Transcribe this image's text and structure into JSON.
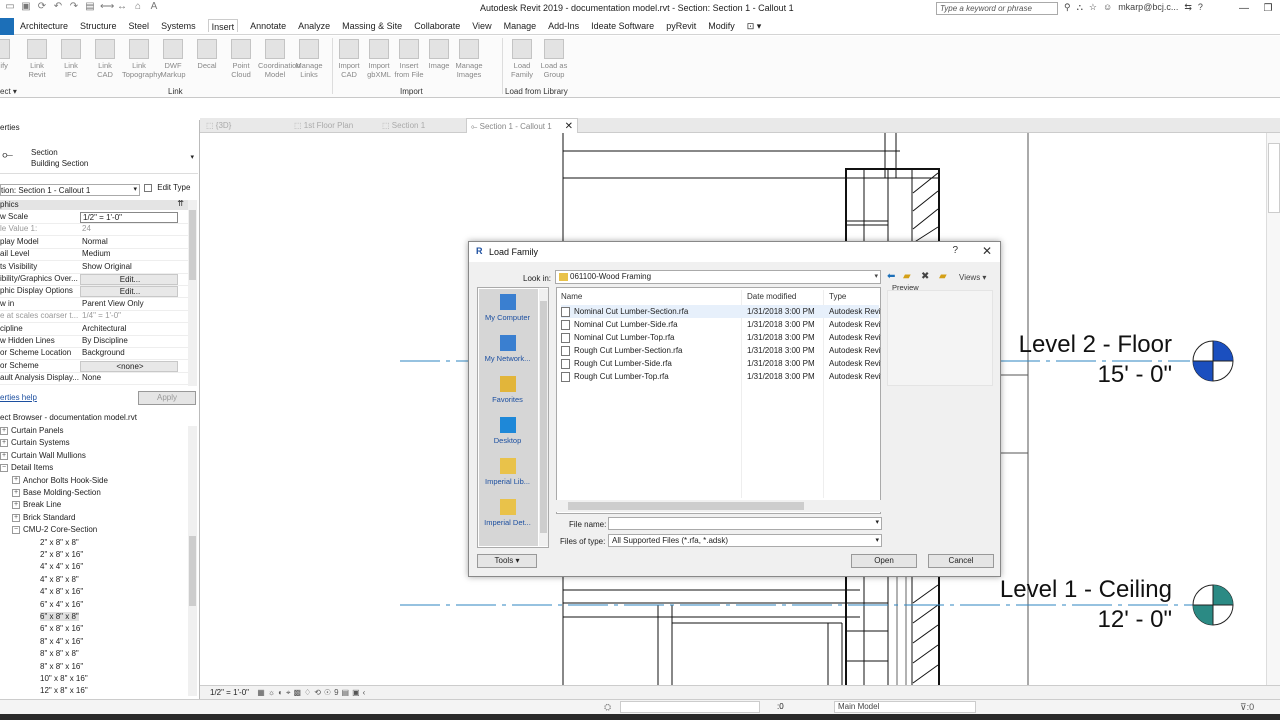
{
  "titlebar": {
    "title": "Autodesk Revit 2019 - documentation model.rvt - Section: Section 1 - Callout 1",
    "search_placeholder": "Type a keyword or phrase",
    "user": "mkarp@bcj.c..."
  },
  "menu": {
    "tabs": [
      "Architecture",
      "Structure",
      "Steel",
      "Systems",
      "Insert",
      "Annotate",
      "Analyze",
      "Massing & Site",
      "Collaborate",
      "View",
      "Manage",
      "Add-Ins",
      "Ideate Software",
      "pyRevit",
      "Modify"
    ],
    "active": "Insert"
  },
  "ribbon": {
    "link_buttons": [
      "Link\nRevit",
      "Link\nIFC",
      "Link\nCAD",
      "Link\nTopography",
      "DWF\nMarkup",
      "Decal",
      "Point\nCloud",
      "Coordination\nModel",
      "Manage\nLinks"
    ],
    "import_buttons": [
      "Import\nCAD",
      "Import\ngbXML",
      "Insert\nfrom File",
      "Image",
      "Manage\nImages"
    ],
    "library_buttons": [
      "Load\nFamily",
      "Load as\nGroup"
    ],
    "panels": {
      "link": "Link",
      "import": "Import",
      "library": "Load from Library"
    },
    "left_clipped": [
      "odify",
      "ect"
    ]
  },
  "properties": {
    "header": "erties",
    "type_name": "Section",
    "type_sub": "Building Section",
    "instance": "tion: Section 1 - Callout 1",
    "edit_type": "Edit Type",
    "section": "phics",
    "rows": [
      {
        "k": "w Scale",
        "v": "1/2\" = 1'-0\"",
        "style": "box"
      },
      {
        "k": "le Value    1:",
        "v": "24",
        "style": "grey"
      },
      {
        "k": "play Model",
        "v": "Normal",
        "style": ""
      },
      {
        "k": "ail Level",
        "v": "Medium",
        "style": ""
      },
      {
        "k": "ts Visibility",
        "v": "Show Original",
        "style": ""
      },
      {
        "k": "ibility/Graphics Over...",
        "v": "Edit...",
        "style": "btn"
      },
      {
        "k": "phic Display Options",
        "v": "Edit...",
        "style": "btn"
      },
      {
        "k": "w in",
        "v": "Parent View Only",
        "style": ""
      },
      {
        "k": "e at scales coarser t...",
        "v": "1/4\" = 1'-0\"",
        "style": "grey"
      },
      {
        "k": "cipline",
        "v": "Architectural",
        "style": ""
      },
      {
        "k": "w Hidden Lines",
        "v": "By Discipline",
        "style": ""
      },
      {
        "k": "or Scheme Location",
        "v": "Background",
        "style": ""
      },
      {
        "k": "or Scheme",
        "v": "<none>",
        "style": "btn"
      },
      {
        "k": "ault Analysis Display...",
        "v": "None",
        "style": ""
      }
    ],
    "help": "erties help",
    "apply": "Apply"
  },
  "browser": {
    "header": "ect Browser - documentation model.rvt",
    "items": [
      {
        "label": "Curtain Panels",
        "indent": 0,
        "tog": "+"
      },
      {
        "label": "Curtain Systems",
        "indent": 0,
        "tog": "+"
      },
      {
        "label": "Curtain Wall Mullions",
        "indent": 0,
        "tog": "+"
      },
      {
        "label": "Detail Items",
        "indent": 0,
        "tog": "-"
      },
      {
        "label": "Anchor Bolts Hook-Side",
        "indent": 1,
        "tog": "+"
      },
      {
        "label": "Base Molding-Section",
        "indent": 1,
        "tog": "+"
      },
      {
        "label": "Break Line",
        "indent": 1,
        "tog": "+"
      },
      {
        "label": "Brick Standard",
        "indent": 1,
        "tog": "+"
      },
      {
        "label": "CMU-2 Core-Section",
        "indent": 1,
        "tog": "-"
      },
      {
        "label": "2\" x 8\" x 8\"",
        "indent": 2,
        "tog": ""
      },
      {
        "label": "2\" x 8\" x 16\"",
        "indent": 2,
        "tog": ""
      },
      {
        "label": "4\" x 4\" x 16\"",
        "indent": 2,
        "tog": ""
      },
      {
        "label": "4\" x 8\" x 8\"",
        "indent": 2,
        "tog": ""
      },
      {
        "label": "4\" x 8\" x 16\"",
        "indent": 2,
        "tog": ""
      },
      {
        "label": "6\" x 4\" x 16\"",
        "indent": 2,
        "tog": ""
      },
      {
        "label": "6\" x 8\" x 8\"",
        "indent": 2,
        "tog": "",
        "sel": true
      },
      {
        "label": "6\" x 8\" x 16\"",
        "indent": 2,
        "tog": ""
      },
      {
        "label": "8\" x 4\" x 16\"",
        "indent": 2,
        "tog": ""
      },
      {
        "label": "8\" x 8\" x 8\"",
        "indent": 2,
        "tog": ""
      },
      {
        "label": "8\" x 8\" x 16\"",
        "indent": 2,
        "tog": ""
      },
      {
        "label": "10\" x 8\" x 16\"",
        "indent": 2,
        "tog": ""
      },
      {
        "label": "12\" x 8\" x 16\"",
        "indent": 2,
        "tog": ""
      }
    ]
  },
  "viewtabs": [
    "{3D}",
    "1st Floor Plan",
    "Section 1",
    "Section 1 - Callout 1"
  ],
  "canvas": {
    "level2_name": "Level 2 - Floor",
    "level2_elev": "15' - 0\"",
    "level1_name": "Level 1 - Ceiling",
    "level1_elev": "12' - 0\""
  },
  "viewcontrol": {
    "scale": "1/2\" = 1'-0\""
  },
  "statusbar": {
    "model": "Main Model",
    "count": ":0"
  },
  "dialog": {
    "title": "Load Family",
    "lookin_label": "Look in:",
    "lookin_value": "061100-Wood Framing",
    "views": "Views",
    "places": [
      "My Computer",
      "My Network...",
      "Favorites",
      "Desktop",
      "Imperial Lib...",
      "Imperial Det..."
    ],
    "columns": {
      "name": "Name",
      "date": "Date modified",
      "type": "Type"
    },
    "files": [
      {
        "name": "Nominal Cut Lumber-Section.rfa",
        "date": "1/31/2018 3:00 PM",
        "type": "Autodesk Revit"
      },
      {
        "name": "Nominal Cut Lumber-Side.rfa",
        "date": "1/31/2018 3:00 PM",
        "type": "Autodesk Revit"
      },
      {
        "name": "Nominal Cut Lumber-Top.rfa",
        "date": "1/31/2018 3:00 PM",
        "type": "Autodesk Revit"
      },
      {
        "name": "Rough Cut Lumber-Section.rfa",
        "date": "1/31/2018 3:00 PM",
        "type": "Autodesk Revit"
      },
      {
        "name": "Rough Cut Lumber-Side.rfa",
        "date": "1/31/2018 3:00 PM",
        "type": "Autodesk Revit"
      },
      {
        "name": "Rough Cut Lumber-Top.rfa",
        "date": "1/31/2018 3:00 PM",
        "type": "Autodesk Revit"
      }
    ],
    "preview": "Preview",
    "filename_label": "File name:",
    "filename_value": "",
    "filetype_label": "Files of type:",
    "filetype_value": "All Supported Files  (*.rfa, *.adsk)",
    "tools": "Tools",
    "open": "Open",
    "cancel": "Cancel"
  }
}
